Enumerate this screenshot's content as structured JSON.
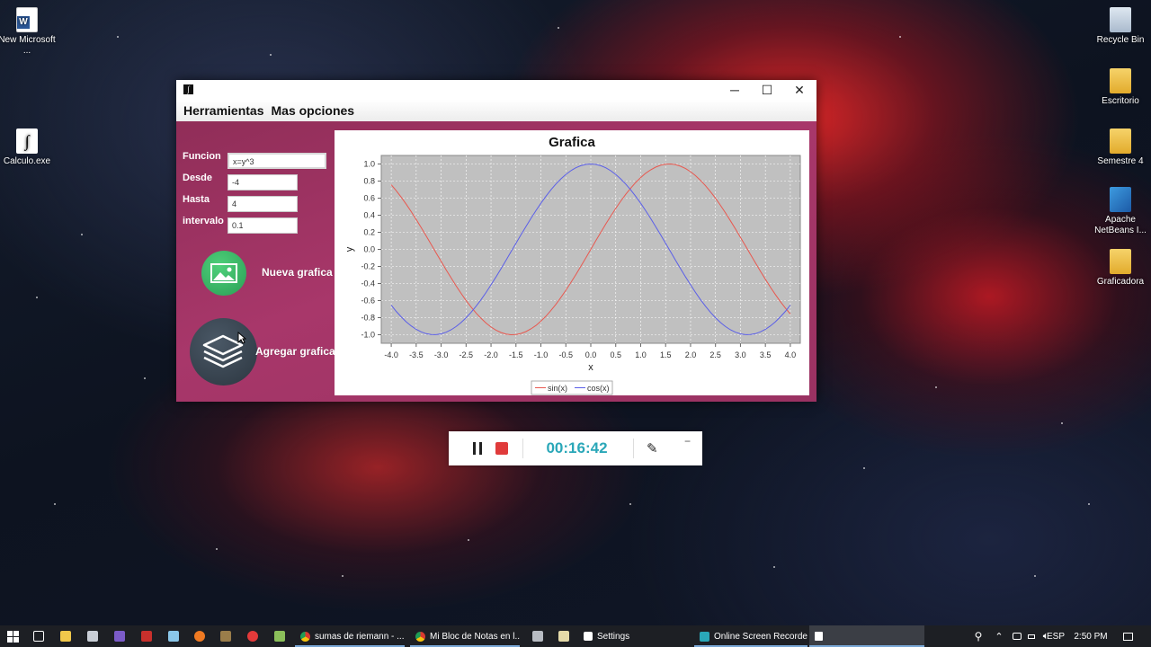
{
  "desktop": {
    "icons_left": [
      {
        "label": "New Microsoft ...",
        "icon": "word-document-icon"
      },
      {
        "label": "Calculo.exe",
        "icon": "integral-app-icon"
      }
    ],
    "icons_right": [
      {
        "label": "Recycle Bin",
        "icon": "recycle-bin-icon"
      },
      {
        "label": "Escritorio",
        "icon": "folder-icon"
      },
      {
        "label": "Semestre 4",
        "icon": "folder-icon"
      },
      {
        "label": "Apache NetBeans I...",
        "icon": "netbeans-icon"
      },
      {
        "label": "Graficadora",
        "icon": "folder-icon"
      }
    ]
  },
  "window": {
    "title": "",
    "controls": {
      "minimize": "─",
      "maximize": "☐",
      "close": "✕"
    },
    "menu": [
      "Herramientas",
      "Mas opciones"
    ],
    "form": {
      "funcion_label": "Funcion",
      "funcion_value": "x=y^3",
      "desde_label": "Desde",
      "desde_value": "-4",
      "hasta_label": "Hasta",
      "hasta_value": "4",
      "intervalo_label": "intervalo",
      "intervalo_value": "0.1"
    },
    "buttons": {
      "nueva": "Nueva grafica",
      "agregar": "Agregar grafica"
    }
  },
  "chart_data": {
    "type": "line",
    "title": "Grafica",
    "xlabel": "x",
    "ylabel": "y",
    "xlim": [
      -4.2,
      4.2
    ],
    "ylim": [
      -1.1,
      1.1
    ],
    "xticks": [
      "-4.0",
      "-3.5",
      "-3.0",
      "-2.5",
      "-2.0",
      "-1.5",
      "-1.0",
      "-0.5",
      "0.0",
      "0.5",
      "1.0",
      "1.5",
      "2.0",
      "2.5",
      "3.0",
      "3.5",
      "4.0"
    ],
    "yticks": [
      "1.0",
      "0.8",
      "0.6",
      "0.4",
      "0.2",
      "0.0",
      "-0.2",
      "-0.4",
      "-0.6",
      "-0.8",
      "-1.0"
    ],
    "grid": true,
    "legend_position": "bottom-center",
    "plot_background": "#c0c0c0",
    "series": [
      {
        "name": "sin(x)",
        "color": "#e8584f",
        "function": "sin",
        "x_range": [
          -4.0,
          4.0
        ],
        "step": 0.1
      },
      {
        "name": "cos(x)",
        "color": "#5a5ee8",
        "function": "cos",
        "x_range": [
          -4.0,
          4.0
        ],
        "step": 0.1
      }
    ]
  },
  "recorder": {
    "time": "00:16:42",
    "pause_icon": "pause-icon",
    "stop_icon": "stop-icon",
    "pen_icon": "pen-icon",
    "minimize": "−"
  },
  "taskbar": {
    "tasks": [
      {
        "label": "sumas de riemann - ...",
        "icon": "chrome-icon"
      },
      {
        "label": "Mi Bloc de Notas en l...",
        "icon": "chrome-icon"
      },
      {
        "label": "Settings",
        "icon": "gear-icon"
      },
      {
        "label": "Online Screen Recorder",
        "icon": "recorder-icon"
      }
    ],
    "language": "ESP",
    "clock": "2:50 PM"
  }
}
